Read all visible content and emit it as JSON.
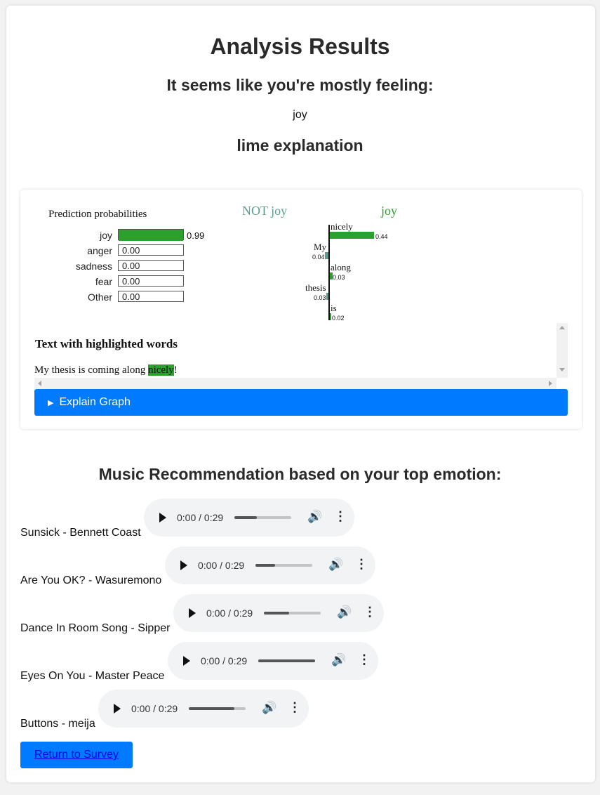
{
  "header": {
    "title": "Analysis Results",
    "subtitle": "It seems like you're mostly feeling:",
    "emotion": "joy",
    "lime_heading": "lime explanation"
  },
  "lime": {
    "prediction_title": "Prediction probabilities",
    "probabilities": [
      {
        "label": "joy",
        "value": "0.99",
        "fraction": 0.99
      },
      {
        "label": "anger",
        "value": "0.00",
        "fraction": 0.0
      },
      {
        "label": "sadness",
        "value": "0.00",
        "fraction": 0.0
      },
      {
        "label": "fear",
        "value": "0.00",
        "fraction": 0.0
      },
      {
        "label": "Other",
        "value": "0.00",
        "fraction": 0.0
      }
    ],
    "not_class_label": "NOT joy",
    "class_label": "joy",
    "features": [
      {
        "word": "nicely",
        "weight": "0.44",
        "side": "joy"
      },
      {
        "word": "My",
        "weight": "0.04",
        "side": "not"
      },
      {
        "word": "along",
        "weight": "0.03",
        "side": "joy"
      },
      {
        "word": "thesis",
        "weight": "0.03",
        "side": "not"
      },
      {
        "word": "is",
        "weight": "0.02",
        "side": "joy"
      }
    ],
    "highlight_title": "Text with highlighted words",
    "text_before": "My thesis is coming along ",
    "text_highlight": "nicely",
    "text_after": "!",
    "explain_label": "Explain Graph",
    "colors": {
      "positive": "#2ca02c",
      "negative": "#5a9e8f",
      "button": "#007bff"
    }
  },
  "music": {
    "heading": "Music Recommendation based on your top emotion:",
    "songs": [
      {
        "title": "Sunsick - Bennett Coast",
        "time": "0:00 / 0:29",
        "volume": 0.4
      },
      {
        "title": "Are You OK? - Wasuremono",
        "time": "0:00 / 0:29",
        "volume": 0.35
      },
      {
        "title": "Dance In Room Song - Sipper",
        "time": "0:00 / 0:29",
        "volume": 0.45
      },
      {
        "title": "Eyes On You - Master Peace",
        "time": "0:00 / 0:29",
        "volume": 1.0
      },
      {
        "title": "Buttons - meija",
        "time": "0:00 / 0:29",
        "volume": 0.8
      }
    ]
  },
  "footer": {
    "return_label": "Return to Survey"
  }
}
